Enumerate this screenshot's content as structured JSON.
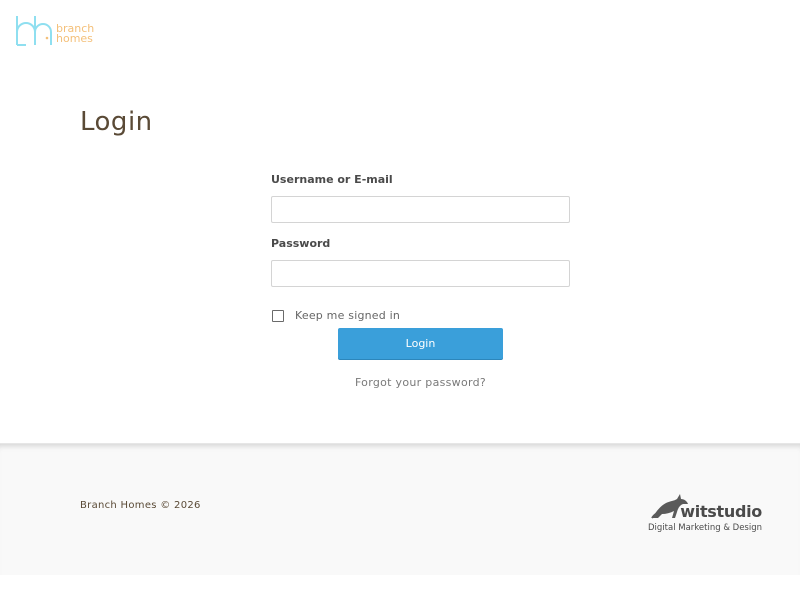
{
  "brand": {
    "logo_mark": "bh",
    "logo_line1": "branch",
    "logo_line2": "homes",
    "colors": {
      "logo_mark": "#8fdff0",
      "logo_text": "#f4c07a",
      "title": "#5a4a36",
      "button": "#3a9fda"
    }
  },
  "page": {
    "title": "Login"
  },
  "form": {
    "username_label": "Username or E-mail",
    "username_value": "",
    "password_label": "Password",
    "password_value": "",
    "remember_label": "Keep me signed in",
    "remember_checked": false,
    "submit_label": "Login",
    "forgot_label": "Forgot your password?"
  },
  "footer": {
    "copyright": "Branch Homes © 2026",
    "credit_brand": "witstudio",
    "credit_tagline": "Digital Marketing & Design",
    "credit_icon": "fox-icon"
  }
}
